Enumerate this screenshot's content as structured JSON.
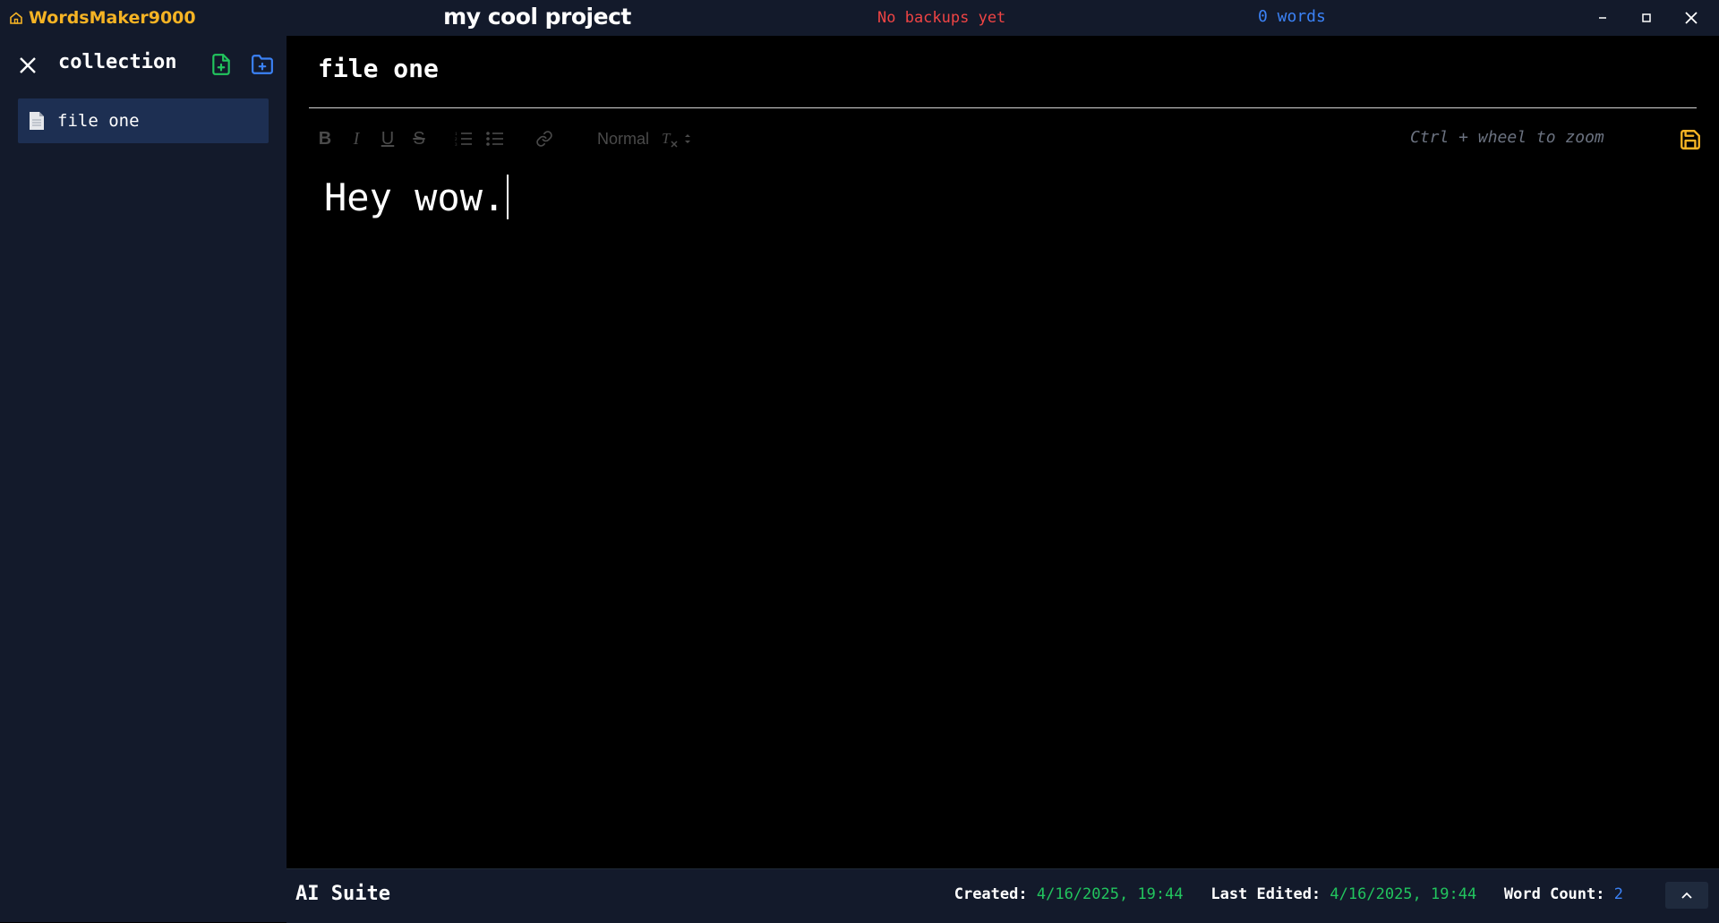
{
  "titlebar": {
    "app_name": "WordsMaker9000",
    "project_title": "my cool project",
    "backup_status": "No backups yet",
    "word_status": "0 words",
    "icons": {
      "home": "home-icon",
      "minimize": "minimize-icon",
      "maximize": "maximize-icon",
      "close": "close-icon"
    }
  },
  "sidebar": {
    "title": "collection",
    "items": [
      {
        "label": "file one",
        "icon": "document-icon",
        "selected": true
      }
    ],
    "icons": {
      "close": "close-icon",
      "new_file": "file-plus-icon",
      "new_folder": "folder-plus-icon"
    }
  },
  "editor": {
    "doc_title": "file one",
    "toolbar": {
      "bold": "B",
      "italic": "I",
      "underline": "U",
      "strike": "S",
      "format_value": "Normal",
      "zoom_hint": "Ctrl + wheel to zoom"
    },
    "content": "Hey wow."
  },
  "footer": {
    "ai_suite": "AI Suite",
    "created_label": "Created:",
    "created_value": "4/16/2025, 19:44",
    "edited_label": "Last Edited:",
    "edited_value": "4/16/2025, 19:44",
    "count_label": "Word Count:",
    "count_value": "2"
  },
  "colors": {
    "chrome_bg": "#131a2b",
    "brand": "#f5b324",
    "backup_warning": "#ef4444",
    "accent_blue": "#3b82f6",
    "accent_green": "#22c55e",
    "selected_item": "#1d2f52",
    "save_icon": "#f5b324"
  }
}
